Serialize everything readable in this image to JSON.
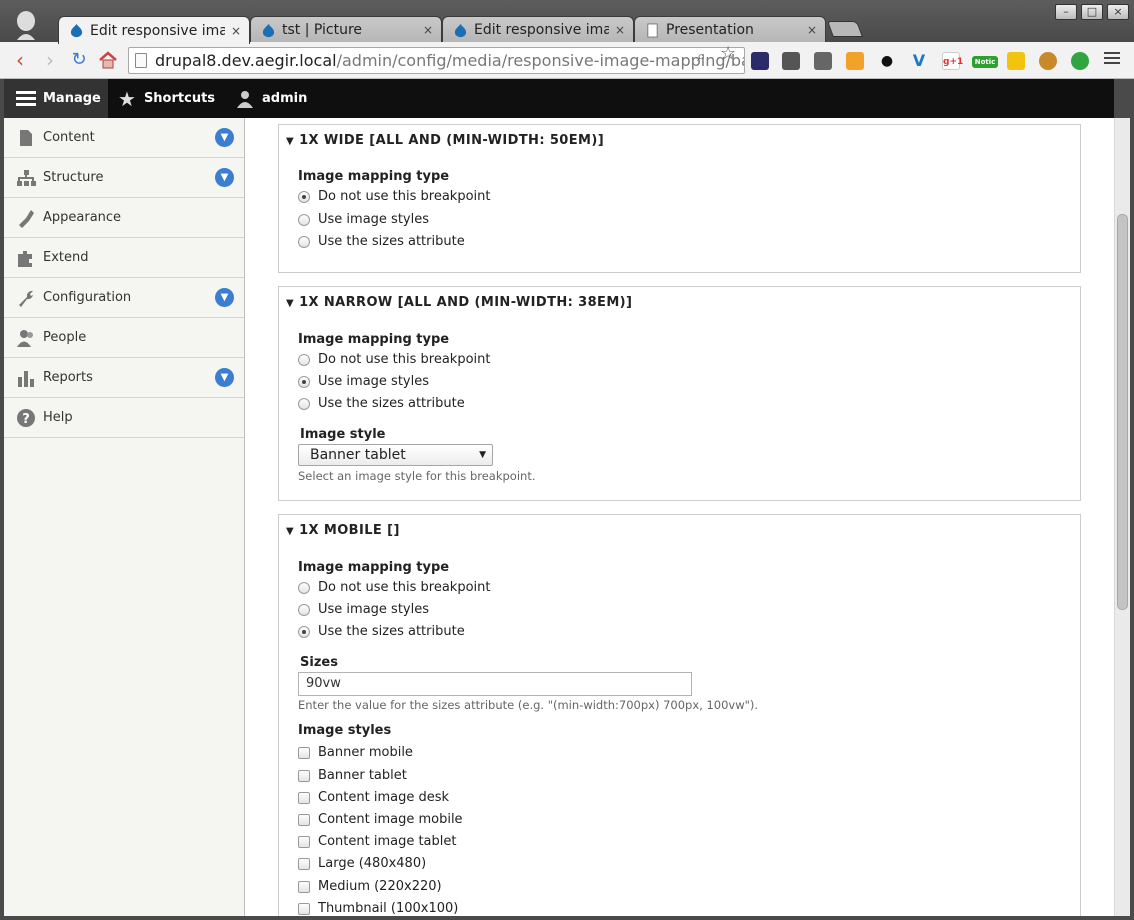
{
  "browser": {
    "tabs": [
      {
        "title": "Edit responsive image",
        "active": true
      },
      {
        "title": "tst | Picture",
        "active": false
      },
      {
        "title": "Edit responsive image",
        "active": false
      },
      {
        "title": "Presentation",
        "active": false
      }
    ],
    "close_glyph": "×",
    "address": {
      "host": "drupal8.dev.aegir.local",
      "path": "/admin/config/media/responsive-image-mapping/ban"
    },
    "extensions": [
      "speed-icon",
      "puzzle-icon",
      "bridge-icon",
      "fire-icon",
      "eye-icon",
      "vimeo-icon",
      "g+1",
      "Notic",
      "phone-icon",
      "cookie-icon",
      "balloon-icon"
    ],
    "ext_labels": {
      "gplus": "g+1",
      "notice": "Notic"
    },
    "window_controls": {
      "minimize": "–",
      "maximize": "□",
      "close": "×"
    }
  },
  "toolbar": {
    "manage": "Manage",
    "shortcuts": "Shortcuts",
    "user": "admin"
  },
  "sidebar": {
    "items": [
      {
        "label": "Content",
        "icon": "content-icon",
        "expandable": true
      },
      {
        "label": "Structure",
        "icon": "structure-icon",
        "expandable": true
      },
      {
        "label": "Appearance",
        "icon": "appearance-icon",
        "expandable": false
      },
      {
        "label": "Extend",
        "icon": "extend-icon",
        "expandable": false
      },
      {
        "label": "Configuration",
        "icon": "configuration-icon",
        "expandable": true
      },
      {
        "label": "People",
        "icon": "people-icon",
        "expandable": false
      },
      {
        "label": "Reports",
        "icon": "reports-icon",
        "expandable": true
      },
      {
        "label": "Help",
        "icon": "help-icon",
        "expandable": false
      }
    ]
  },
  "colors": {
    "accent": "#3b7ed0",
    "toolbar": "#0f0f0f"
  },
  "breakpoints": [
    {
      "summary": "1X WIDE [ALL AND (MIN-WIDTH: 50EM)]",
      "mapping_label": "Image mapping type",
      "options": [
        "Do not use this breakpoint",
        "Use image styles",
        "Use the sizes attribute"
      ],
      "selected": 0
    },
    {
      "summary": "1X NARROW [ALL AND (MIN-WIDTH: 38EM)]",
      "mapping_label": "Image mapping type",
      "options": [
        "Do not use this breakpoint",
        "Use image styles",
        "Use the sizes attribute"
      ],
      "selected": 1,
      "image_style_label": "Image style",
      "image_style_value": "Banner tablet",
      "image_style_desc": "Select an image style for this breakpoint."
    },
    {
      "summary": "1X MOBILE []",
      "mapping_label": "Image mapping type",
      "options": [
        "Do not use this breakpoint",
        "Use image styles",
        "Use the sizes attribute"
      ],
      "selected": 2,
      "sizes_label": "Sizes",
      "sizes_value": "90vw",
      "sizes_desc": "Enter the value for the sizes attribute (e.g. \"(min-width:700px) 700px, 100vw\").",
      "styles_label": "Image styles",
      "styles": [
        "Banner mobile",
        "Banner tablet",
        "Content image desk",
        "Content image mobile",
        "Content image tablet",
        "Large (480x480)",
        "Medium (220x220)",
        "Thumbnail (100x100)"
      ]
    }
  ]
}
